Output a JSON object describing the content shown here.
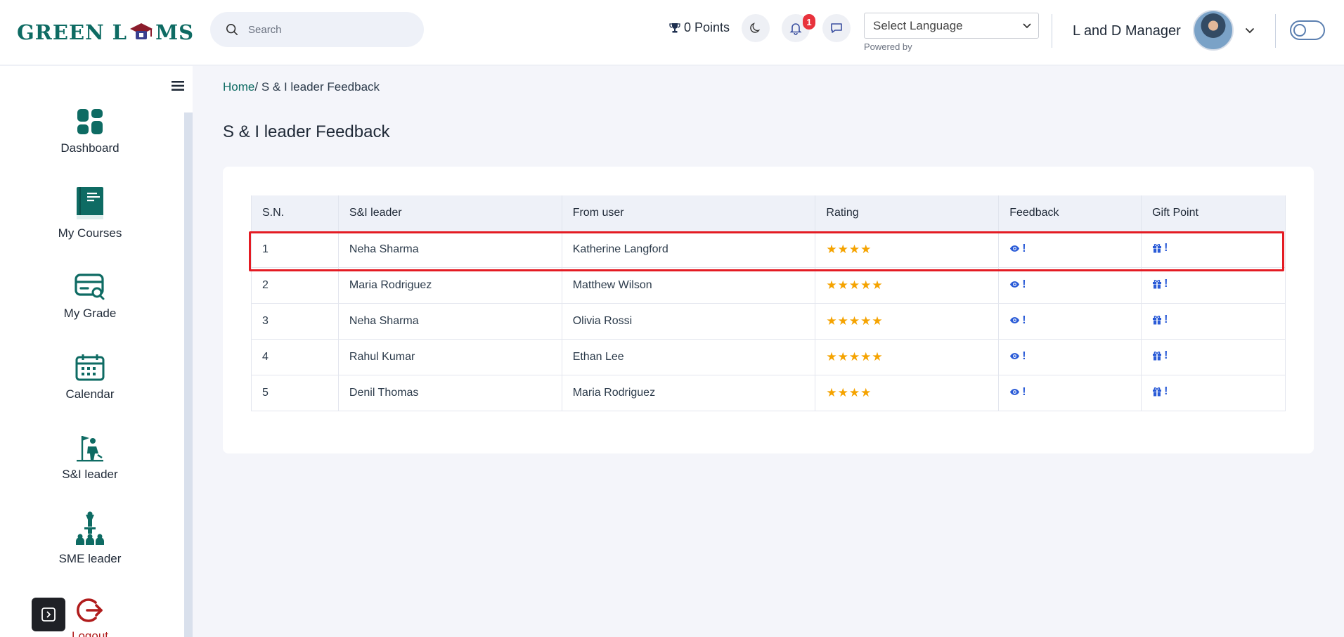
{
  "header": {
    "logo_text_left": "GREEN L",
    "logo_text_right": "MS",
    "search_placeholder": "Search",
    "points_label": "0 Points",
    "notification_count": "1",
    "language_select": "Select Language",
    "powered_by": "Powered by",
    "user_name": "L and D Manager"
  },
  "sidebar": {
    "items": [
      {
        "label": "Dashboard",
        "icon": "dashboard-icon"
      },
      {
        "label": "My Courses",
        "icon": "book-icon"
      },
      {
        "label": "My Grade",
        "icon": "grade-card-icon"
      },
      {
        "label": "Calendar",
        "icon": "calendar-icon"
      },
      {
        "label": "S&I leader",
        "icon": "si-leader-icon"
      },
      {
        "label": "SME leader",
        "icon": "sme-leader-icon"
      },
      {
        "label": "Logout",
        "icon": "logout-icon"
      }
    ]
  },
  "breadcrumb": {
    "home": "Home",
    "separator": "/",
    "current": "S & I leader Feedback"
  },
  "page_title": "S & I leader Feedback",
  "table": {
    "headers": [
      "S.N.",
      "S&I leader",
      "From user",
      "Rating",
      "Feedback",
      "Gift Point"
    ],
    "rows": [
      {
        "sn": "1",
        "leader": "Neha Sharma",
        "from_user": "Katherine Langford",
        "rating": 4
      },
      {
        "sn": "2",
        "leader": "Maria Rodriguez",
        "from_user": "Matthew Wilson",
        "rating": 5
      },
      {
        "sn": "3",
        "leader": "Neha Sharma",
        "from_user": "Olivia Rossi",
        "rating": 5
      },
      {
        "sn": "4",
        "leader": "Rahul Kumar",
        "from_user": "Ethan Lee",
        "rating": 5
      },
      {
        "sn": "5",
        "leader": "Denil Thomas",
        "from_user": "Maria Rodriguez",
        "rating": 4
      }
    ],
    "action_mark": "!"
  },
  "colors": {
    "brand": "#0e6b63",
    "star": "#f5a300",
    "action": "#2a5bd7",
    "highlight": "#e41b23",
    "logout": "#b01c1c"
  }
}
